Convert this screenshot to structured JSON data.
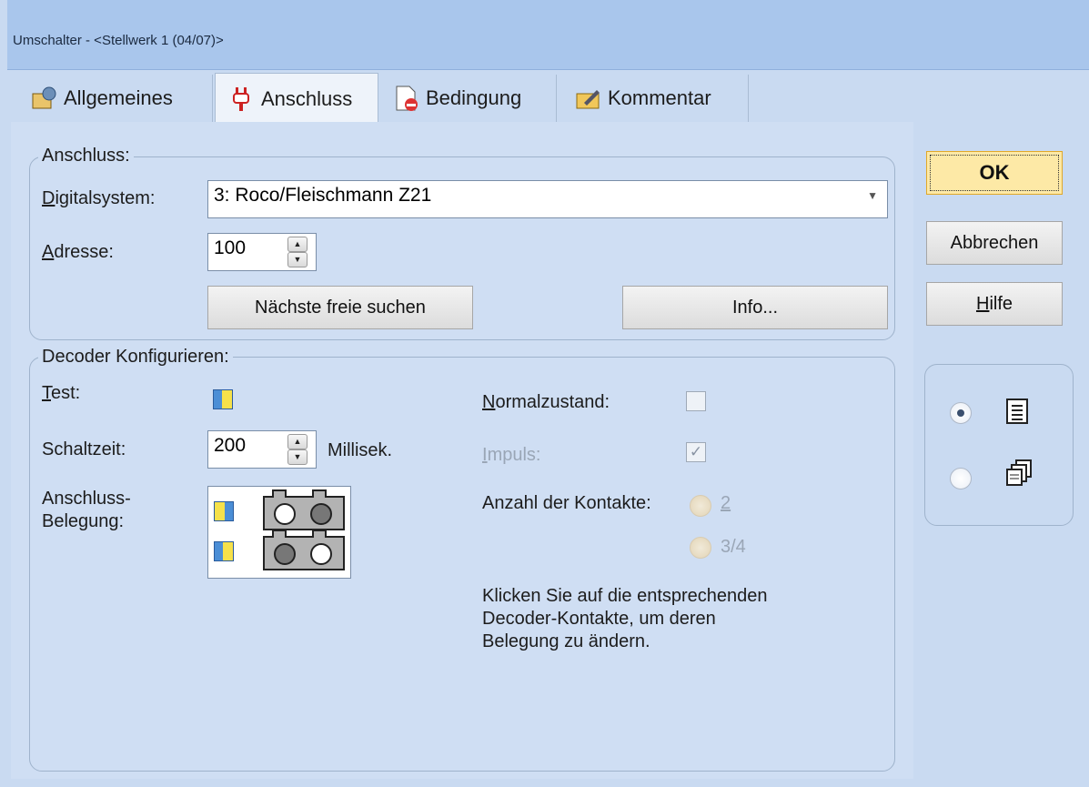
{
  "window": {
    "title": "Umschalter - <Stellwerk 1 (04/07)>"
  },
  "tabs": [
    {
      "label": "Allgemeines",
      "icon": "settings-icon"
    },
    {
      "label": "Anschluss",
      "icon": "plug-icon"
    },
    {
      "label": "Bedingung",
      "icon": "condition-icon"
    },
    {
      "label": "Kommentar",
      "icon": "comment-icon"
    }
  ],
  "anschluss": {
    "group_label": "Anschluss:",
    "digitalsystem_label": "Digitalsystem:",
    "digitalsystem_value": "3: Roco/Fleischmann Z21",
    "adresse_label": "Adresse:",
    "adresse_value": "100",
    "next_free_button": "Nächste freie suchen",
    "info_button": "Info..."
  },
  "decoder": {
    "group_label": "Decoder Konfigurieren:",
    "test_label": "Test:",
    "schaltzeit_label": "Schaltzeit:",
    "schaltzeit_value": "200",
    "schaltzeit_unit": "Millisek.",
    "belegung_label_1": "Anschluss-",
    "belegung_label_2": "Belegung:",
    "normalzustand_label": "Normalzustand:",
    "impuls_label": "Impuls:",
    "kontakte_label": "Anzahl der Kontakte:",
    "kontakte_option_1": "2",
    "kontakte_option_2": "3/4",
    "hint_line_1": "Klicken Sie auf die entsprechenden",
    "hint_line_2": "Decoder-Kontakte, um deren",
    "hint_line_3": "Belegung zu ändern."
  },
  "buttons": {
    "ok": "OK",
    "cancel": "Abbrechen",
    "help": "Hilfe"
  },
  "view_options": {
    "selected": "list"
  },
  "colors": {
    "ok_bg": "#fde9a6",
    "title_bg": "#a9c6ec",
    "panel_bg": "#cfdef3"
  }
}
